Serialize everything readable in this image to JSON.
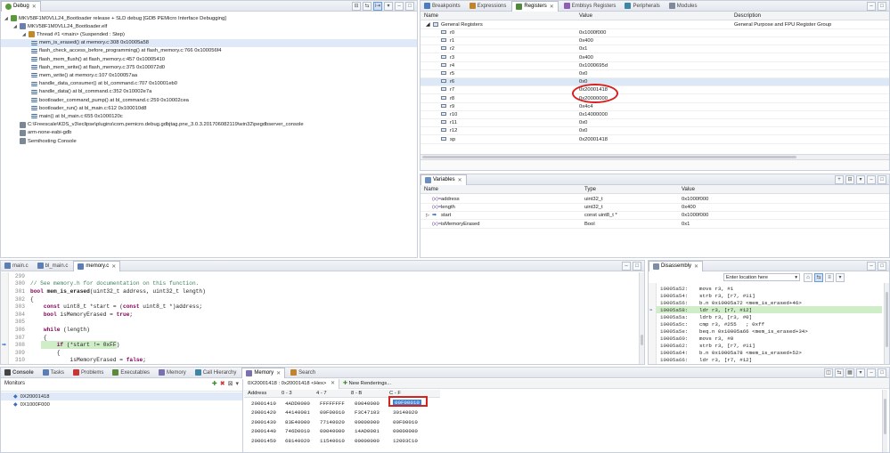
{
  "debug": {
    "tab_label": "Debug",
    "tree": [
      {
        "text": "MKV58F1M0VLL24_Bootloader release + SLD debug [GDB PEMicro Interface Debugging]",
        "indent": 0,
        "icon": "debug-config-icon"
      },
      {
        "text": "MKV58F1M0VLL24_Bootloader.elf",
        "indent": 1,
        "icon": "elf-icon"
      },
      {
        "text": "Thread #1 <main> (Suspended : Step)",
        "indent": 2,
        "icon": "thread-icon"
      },
      {
        "text": "mem_is_erased() at memory.c:308 0x10005a58",
        "indent": 3,
        "icon": "stack-frame-icon",
        "selected": true
      },
      {
        "text": "flash_check_access_before_programming() at flash_memory.c:766 0x100056f4",
        "indent": 3,
        "icon": "stack-frame-icon"
      },
      {
        "text": "flash_mem_flush() at flash_memory.c:457 0x10005410",
        "indent": 3,
        "icon": "stack-frame-icon"
      },
      {
        "text": "flash_mem_write() at flash_memory.c:375 0x100072d0",
        "indent": 3,
        "icon": "stack-frame-icon"
      },
      {
        "text": "mem_write() at memory.c:107 0x100057aa",
        "indent": 3,
        "icon": "stack-frame-icon"
      },
      {
        "text": "handle_data_consumer() at bl_command.c:707 0x10001eb0",
        "indent": 3,
        "icon": "stack-frame-icon"
      },
      {
        "text": "handle_data() at bl_command.c:352 0x10002e7a",
        "indent": 3,
        "icon": "stack-frame-icon"
      },
      {
        "text": "bootloader_command_pump() at bl_command.c:259 0x10002cea",
        "indent": 3,
        "icon": "stack-frame-icon"
      },
      {
        "text": "bootloader_run() at bl_main.c:612 0x100010d8",
        "indent": 3,
        "icon": "stack-frame-icon"
      },
      {
        "text": "main() at bl_main.c:655 0x1000120c",
        "indent": 3,
        "icon": "stack-frame-icon"
      },
      {
        "text": "C:\\Freescale\\KDS_v3\\eclipse\\plugins\\com.pemicro.debug.gdbjtag.pne_3.0.3.201706082119\\win32\\pegdbserver_console",
        "indent": 1,
        "icon": "process-icon"
      },
      {
        "text": "arm-none-eabi-gdb",
        "indent": 1,
        "icon": "process-icon"
      },
      {
        "text": "Semihosting Console",
        "indent": 1,
        "icon": "process-icon"
      }
    ]
  },
  "registers": {
    "tabs": [
      "Breakpoints",
      "Expressions",
      "Registers",
      "Emblsys Registers",
      "Peripherals",
      "Modules"
    ],
    "active_tab": "Registers",
    "columns": [
      "Name",
      "Value",
      "Description"
    ],
    "group": {
      "name": "General Registers",
      "description": "General Purpose and FPU Register Group"
    },
    "rows": [
      {
        "name": "r0",
        "value": "0x1000f000"
      },
      {
        "name": "r1",
        "value": "0x400"
      },
      {
        "name": "r2",
        "value": "0x1"
      },
      {
        "name": "r3",
        "value": "0x400"
      },
      {
        "name": "r4",
        "value": "0x1000695d"
      },
      {
        "name": "r5",
        "value": "0x0"
      },
      {
        "name": "r6",
        "value": "0x0"
      },
      {
        "name": "r7",
        "value": "0x20001418"
      },
      {
        "name": "r8",
        "value": "0x20000000"
      },
      {
        "name": "r9",
        "value": "0x4c4"
      },
      {
        "name": "r10",
        "value": "0x14000000"
      },
      {
        "name": "r11",
        "value": "0x0"
      },
      {
        "name": "r12",
        "value": "0x0"
      },
      {
        "name": "sp",
        "value": "0x20001418"
      }
    ]
  },
  "variables": {
    "tab_label": "Variables",
    "columns": [
      "Name",
      "Type",
      "Value"
    ],
    "rows": [
      {
        "name": "address",
        "type": "uint32_t",
        "value": "0x1000f000"
      },
      {
        "name": "length",
        "type": "uint32_t",
        "value": "0x400"
      },
      {
        "name": "start",
        "type": "const uint8_t *",
        "value": "0x1000f000"
      },
      {
        "name": "isMemoryErased",
        "type": "Bool",
        "value": "0x1"
      }
    ]
  },
  "editor": {
    "tabs": [
      "main.c",
      "bl_main.c",
      "memory.c"
    ],
    "active_tab": "memory.c",
    "lines": [
      {
        "num": "299",
        "text": ""
      },
      {
        "num": "300",
        "text": "// See memory.h for documentation on this function."
      },
      {
        "num": "301",
        "text": "bool mem_is_erased(uint32_t address, uint32_t length)"
      },
      {
        "num": "302",
        "text": "{"
      },
      {
        "num": "303",
        "text": "    const uint8_t *start = (const uint8_t *)address;"
      },
      {
        "num": "304",
        "text": "    bool isMemoryErased = true;"
      },
      {
        "num": "305",
        "text": ""
      },
      {
        "num": "306",
        "text": "    while (length)"
      },
      {
        "num": "307",
        "text": "    {"
      },
      {
        "num": "308",
        "text": "        if (*start != 0xFF)"
      },
      {
        "num": "309",
        "text": "        {"
      },
      {
        "num": "310",
        "text": "            isMemoryErased = false;"
      }
    ]
  },
  "disassembly": {
    "tab_label": "Disassembly",
    "location_placeholder": "Enter location here",
    "lines": [
      {
        "addr": "10005a52:",
        "instr": "movs r3, #1"
      },
      {
        "addr": "10005a54:",
        "instr": "strb r3, [r7, #11]"
      },
      {
        "addr": "10005a56:",
        "instr": "b.n 0x10005a72 <mem_is_erased+46>"
      },
      {
        "addr": "10005a58:",
        "instr": "ldr r3, [r7, #12]",
        "current": true
      },
      {
        "addr": "10005a5a:",
        "instr": "ldrb r3, [r3, #0]"
      },
      {
        "addr": "10005a5c:",
        "instr": "cmp r3, #255   ; 0xff"
      },
      {
        "addr": "10005a5e:",
        "instr": "beq.n 0x10005a66 <mem_is_erased+34>"
      },
      {
        "addr": "10005a60:",
        "instr": "movs r3, #0"
      },
      {
        "addr": "10005a62:",
        "instr": "strb r3, [r7, #11]"
      },
      {
        "addr": "10005a64:",
        "instr": "b.n 0x10005a78 <mem_is_erased+52>"
      },
      {
        "addr": "10005a66:",
        "instr": "ldr r3, [r7, #12]"
      }
    ]
  },
  "bottom": {
    "tabs": [
      "Console",
      "Tasks",
      "Problems",
      "Executables",
      "Memory",
      "Call Hierarchy",
      "Memory",
      "Search"
    ],
    "active_tab_index": 6,
    "monitors_label": "Monitors",
    "monitors": [
      "0X20001418",
      "0X1000F000"
    ],
    "rendering_tab": "0X20001418 : 0x20001418 <Hex>",
    "new_renderings": "New Renderings...",
    "columns": [
      "Address",
      "0 - 3",
      "4 - 7",
      "8 - B",
      "C - F"
    ],
    "rows": [
      {
        "addr": "20001410",
        "c0": "4ADD0000",
        "c1": "FFFFFFFF",
        "c2": "00040000",
        "c3": "00F00010"
      },
      {
        "addr": "20001420",
        "c0": "44140001",
        "c1": "00F00010",
        "c2": "F3C47103",
        "c3": "30140020"
      },
      {
        "addr": "20001430",
        "c0": "83E40000",
        "c1": "77140020",
        "c2": "00000000",
        "c3": "00F00010"
      },
      {
        "addr": "20001440",
        "c0": "746D0010",
        "c1": "00040000",
        "c2": "14AD0001",
        "c3": "00000000"
      },
      {
        "addr": "20001450",
        "c0": "68140020",
        "c1": "11540010",
        "c2": "00000000",
        "c3": "12003C10"
      }
    ]
  },
  "colors": {
    "annotation_red": "#d8201f",
    "selection_blue": "#3b83d8",
    "current_line_green": "#cfeec8"
  }
}
